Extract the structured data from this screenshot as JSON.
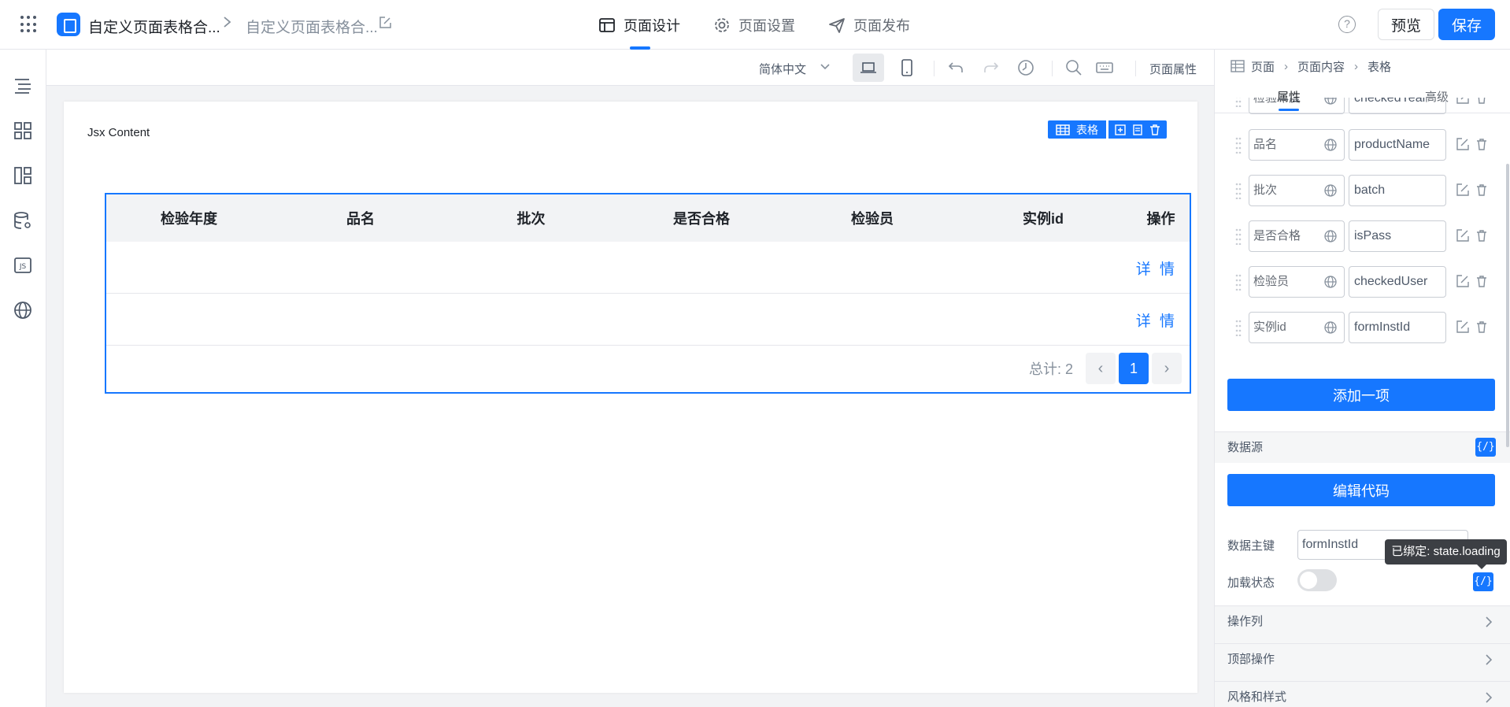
{
  "header": {
    "app_title": "自定义页面表格合...",
    "page_title": "自定义页面表格合...",
    "tabs": [
      {
        "label": "页面设计",
        "icon": "layout-icon",
        "active": true
      },
      {
        "label": "页面设置",
        "icon": "gear-icon",
        "active": false
      },
      {
        "label": "页面发布",
        "icon": "send-icon",
        "active": false
      }
    ],
    "help_glyph": "?",
    "preview_label": "预览",
    "save_label": "保存",
    "accent_color": "#1677ff"
  },
  "left_rail": {
    "icons": [
      "outline-tree-icon",
      "components-grid-icon",
      "layout-blocks-icon",
      "data-source-icon",
      "js-code-icon",
      "globe-icon"
    ]
  },
  "toolbar": {
    "language": "简体中文",
    "page_props_label": "页面属性",
    "icons": [
      "desktop-icon",
      "mobile-icon",
      "undo-icon",
      "redo-icon",
      "history-icon",
      "search-icon",
      "keyboard-icon"
    ]
  },
  "canvas": {
    "jsx_label": "Jsx Content",
    "component_tag": "表格",
    "table": {
      "columns": [
        "检验年度",
        "品名",
        "批次",
        "是否合格",
        "检验员",
        "实例id",
        "操作"
      ],
      "rows": [
        {
          "action": "详 情"
        },
        {
          "action": "详 情"
        }
      ],
      "total_label": "总计: 2",
      "current_page": "1",
      "prev_glyph": "‹",
      "next_glyph": "›"
    }
  },
  "right_panel": {
    "breadcrumb": [
      "页面",
      "页面内容",
      "表格"
    ],
    "tabs": [
      {
        "label": "属性",
        "active": true
      },
      {
        "label": "高级",
        "active": false
      }
    ],
    "columns": [
      {
        "label": "检验年度",
        "key": "checkedYear"
      },
      {
        "label": "品名",
        "key": "productName"
      },
      {
        "label": "批次",
        "key": "batch"
      },
      {
        "label": "是否合格",
        "key": "isPass"
      },
      {
        "label": "检验员",
        "key": "checkedUser"
      },
      {
        "label": "实例id",
        "key": "formInstId"
      }
    ],
    "add_item_label": "添加一项",
    "data_source_label": "数据源",
    "code_badge": "{/}",
    "edit_code_label": "编辑代码",
    "primary_key_label": "数据主键",
    "primary_key_value": "formInstId",
    "tooltip": "已绑定: state.loading",
    "loading_label": "加载状态",
    "loading_on": false,
    "sections": [
      "操作列",
      "顶部操作",
      "风格和样式"
    ]
  }
}
